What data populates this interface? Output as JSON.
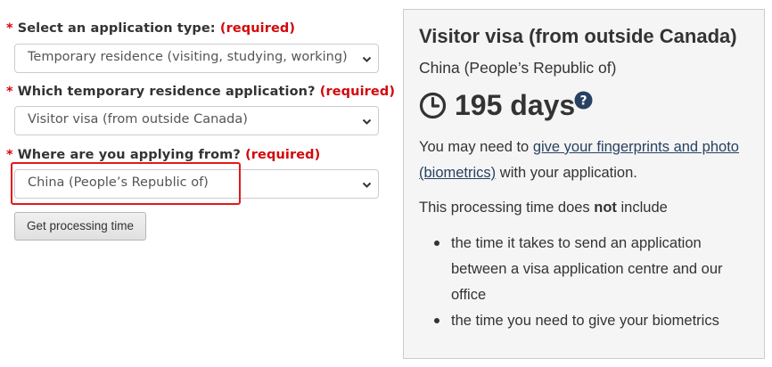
{
  "form": {
    "required_marker": "*",
    "required_text": "(required)",
    "application_type": {
      "label": "Select an application type:",
      "value": "Temporary residence (visiting, studying, working)"
    },
    "temporary_application": {
      "label": "Which temporary residence application?",
      "value": "Visitor visa (from outside Canada)"
    },
    "applying_from": {
      "label": "Where are you applying from?",
      "value": "China (People’s Republic of)"
    },
    "submit_label": "Get processing time"
  },
  "result": {
    "title": "Visitor visa (from outside Canada)",
    "country": "China (People’s Republic of)",
    "processing_time": "195 days",
    "biometrics": {
      "before": "You may need to ",
      "link": "give your fingerprints and photo (biometrics)",
      "after": " with your application."
    },
    "exclusions": {
      "before": "This processing time does ",
      "emphasis": "not",
      "after": " include"
    },
    "exclusion_items": [
      "the time it takes to send an application between a visa application centre and our office",
      "the time you need to give your biometrics"
    ]
  },
  "colors": {
    "required": "#d3080c",
    "link": "#284162",
    "panel_background": "#f5f5f5",
    "highlight_box": "#e11a1a"
  },
  "icons": {
    "clock": "clock-icon",
    "help": "question-circle-icon",
    "dropdown": "chevron-down-icon"
  }
}
